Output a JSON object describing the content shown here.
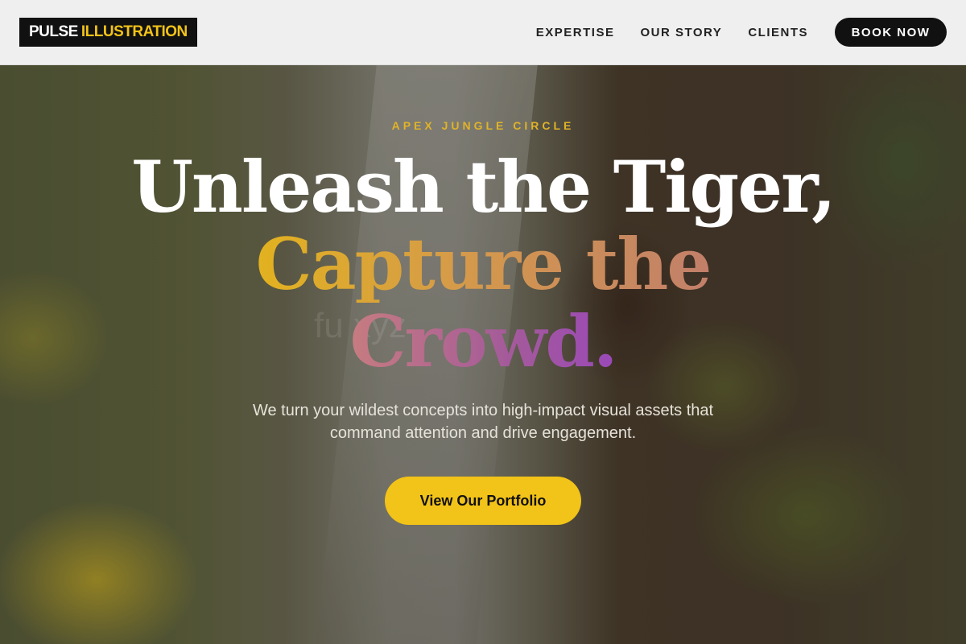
{
  "header": {
    "logo": {
      "part1": "PULSE",
      "part2": "ILLUSTRATION"
    },
    "nav": [
      {
        "label": "EXPERTISE"
      },
      {
        "label": "OUR STORY"
      },
      {
        "label": "CLIENTS"
      }
    ],
    "cta": "BOOK NOW"
  },
  "hero": {
    "eyebrow": "APEX JUNGLE CIRCLE",
    "headline": {
      "line1": "Unleash the Tiger,",
      "line2": "Capture the",
      "line3": "Crowd."
    },
    "subtitle": "We turn your wildest concepts into high-impact visual assets that command attention and drive engagement.",
    "cta": "View Our Portfolio",
    "watermark": "fu          xyz"
  },
  "colors": {
    "accent_yellow": "#f2c318",
    "dark": "#111111",
    "header_bg": "#efefef"
  }
}
